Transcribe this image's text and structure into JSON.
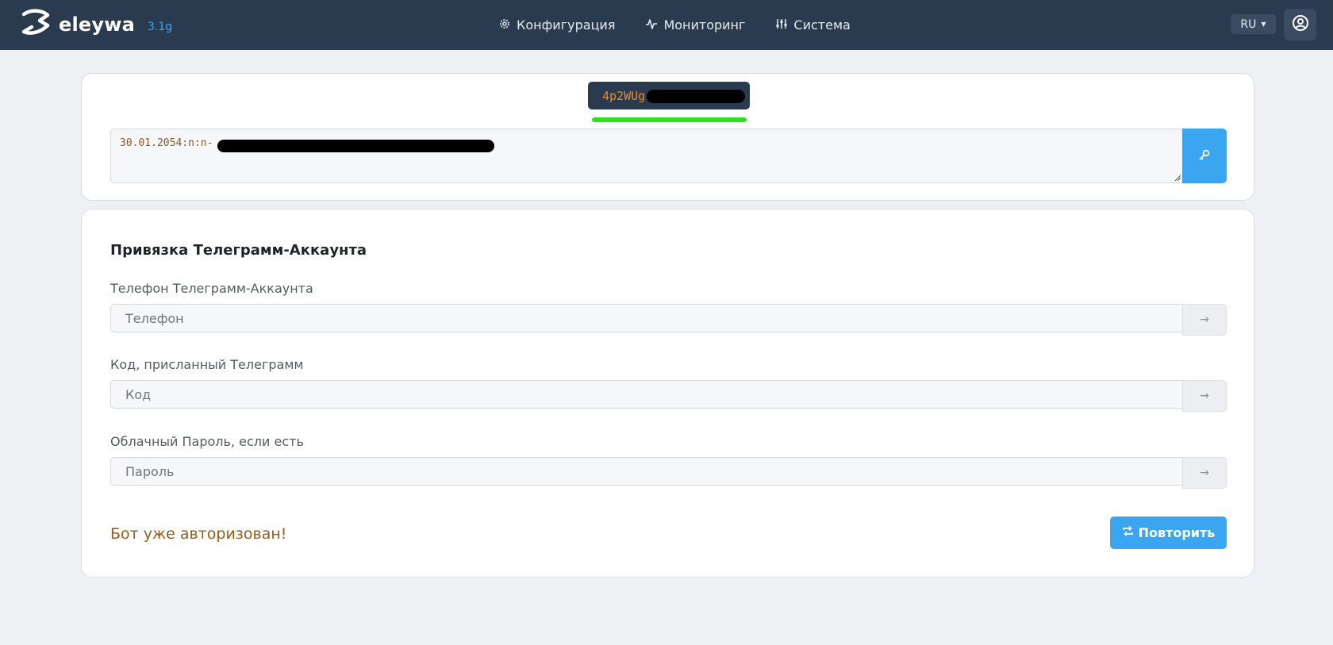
{
  "header": {
    "brand_name": "eleywa",
    "version": "3.1g",
    "nav": [
      {
        "label": "Конфигурация",
        "icon": "gear-icon"
      },
      {
        "label": "Мониторинг",
        "icon": "pulse-icon"
      },
      {
        "label": "Система",
        "icon": "sliders-icon"
      }
    ],
    "language": "RU",
    "user_icon": "user-circle-icon"
  },
  "token": {
    "prefix": "4p2WUg",
    "key_text": "30.01.2054:n:n-"
  },
  "telegram": {
    "title": "Привязка Телеграмм-Аккаунта",
    "phone_label": "Телефон Телеграмм-Аккаунта",
    "phone_placeholder": "Телефон",
    "code_label": "Код, присланный Телеграмм",
    "code_placeholder": "Код",
    "password_label": "Облачный Пароль, если есть",
    "password_placeholder": "Пароль",
    "submit_glyph": "→",
    "status": "Бот уже авторизован!",
    "retry_label": "Повторить"
  },
  "colors": {
    "header_bg": "#2a3a4f",
    "accent": "#3aa6f0",
    "token_text": "#e88a2a",
    "progress": "#33dd22",
    "status_text": "#9a5a1a"
  }
}
